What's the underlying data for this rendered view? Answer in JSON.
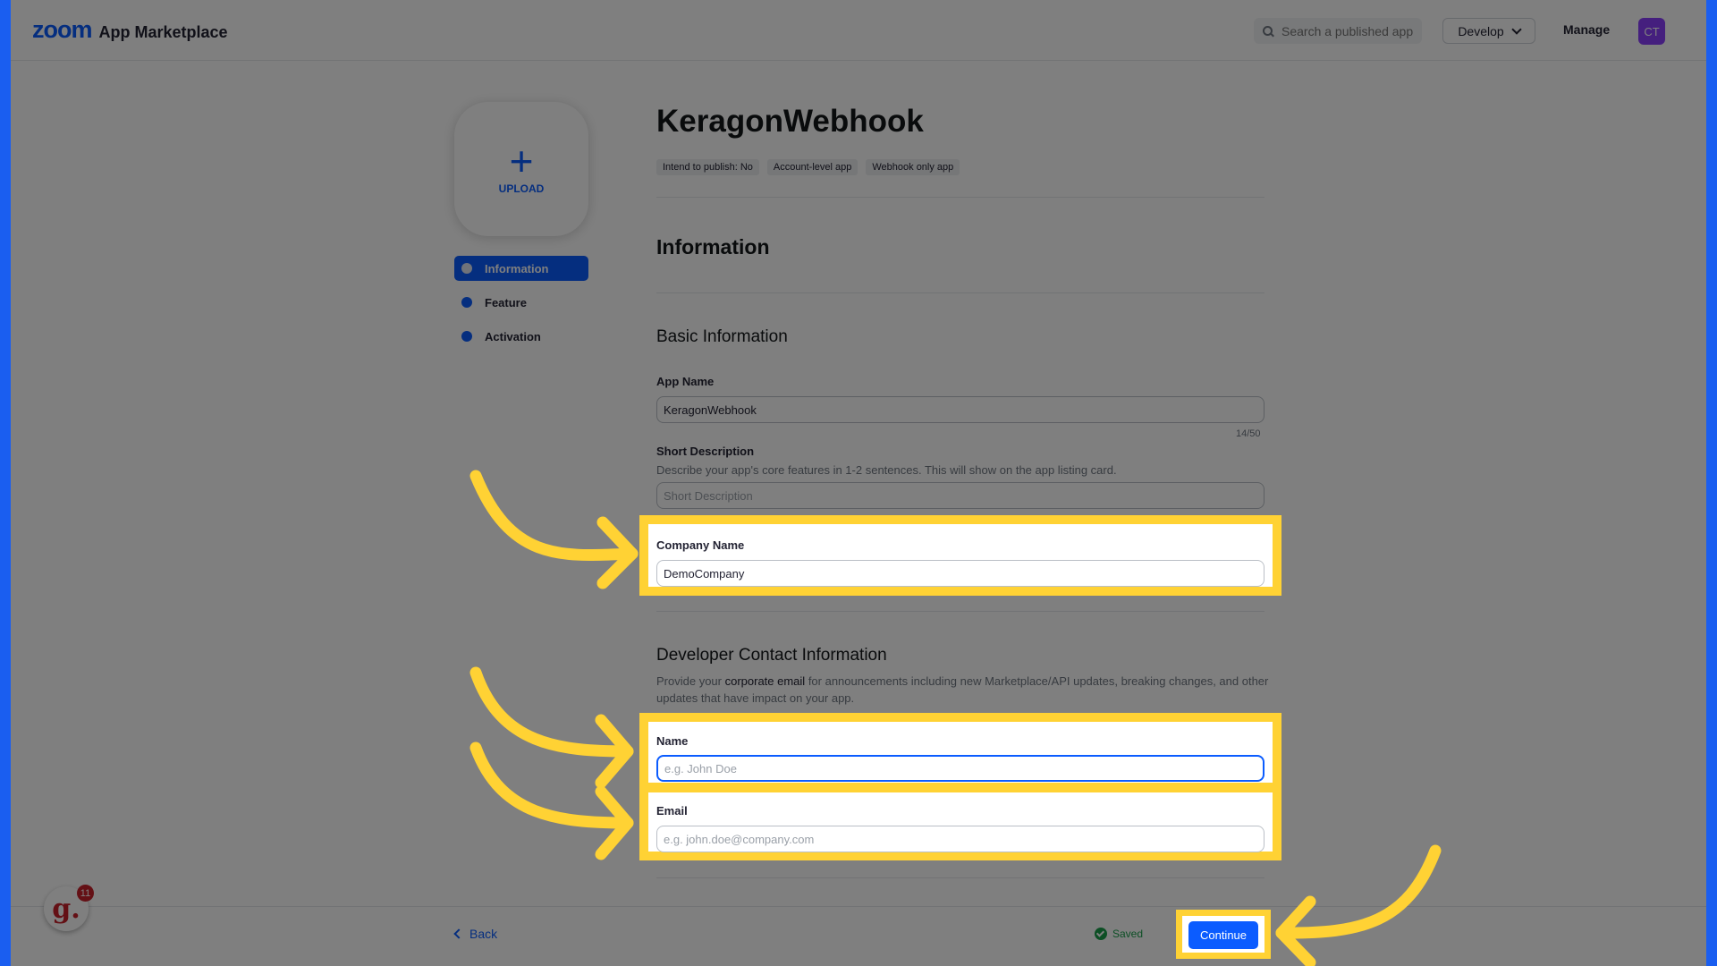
{
  "header": {
    "logo_zoom": "zoom",
    "logo_text": "App Marketplace",
    "search_placeholder": "Search a published app",
    "develop_label": "Develop",
    "manage_label": "Manage",
    "avatar_initials": "CT"
  },
  "sidebar": {
    "upload_label": "UPLOAD",
    "items": [
      {
        "label": "Information",
        "active": true
      },
      {
        "label": "Feature",
        "active": false
      },
      {
        "label": "Activation",
        "active": false
      }
    ]
  },
  "app": {
    "title": "KeragonWebhook",
    "tags": [
      "Intend to publish: No",
      "Account-level app",
      "Webhook only app"
    ]
  },
  "information": {
    "section_title": "Information",
    "basic_title": "Basic Information",
    "app_name_label": "App Name",
    "app_name_value": "KeragonWebhook",
    "app_name_counter": "14/50",
    "short_desc_label": "Short Description",
    "short_desc_help": "Describe your app's core features in 1-2 sentences. This will show on the app listing card.",
    "short_desc_placeholder": "Short Description",
    "company_label": "Company Name",
    "company_value": "DemoCompany"
  },
  "developer": {
    "title": "Developer Contact Information",
    "help_before": "Provide your ",
    "help_bold": "corporate email",
    "help_after": " for announcements including new Marketplace/API updates, breaking changes, and other updates that have impact on your app.",
    "name_label": "Name",
    "name_placeholder": "e.g. John Doe",
    "email_label": "Email",
    "email_placeholder": "e.g. john.doe@company.com"
  },
  "footer": {
    "back_label": "Back",
    "saved_label": "Saved",
    "continue_label": "Continue"
  },
  "badge": {
    "letter": "g.",
    "count": "11"
  },
  "colors": {
    "accent": "#0b5cff",
    "highlight": "#ffd234",
    "saved": "#1a9e4b"
  }
}
